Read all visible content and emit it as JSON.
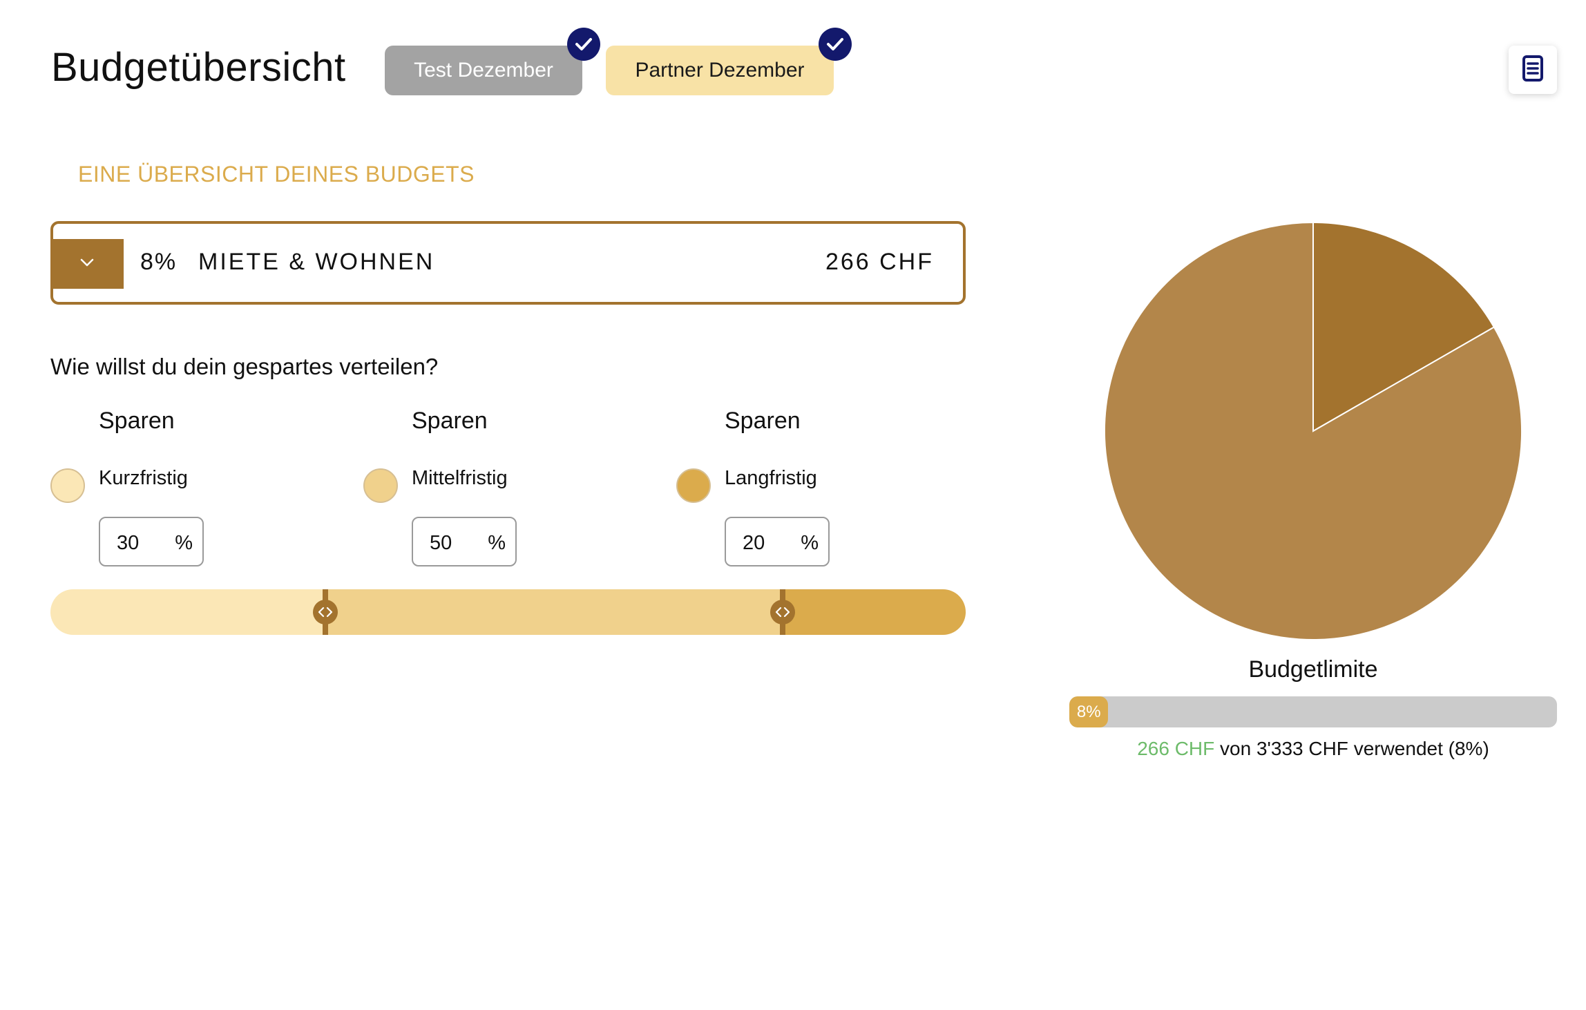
{
  "header": {
    "title": "Budgetübersicht",
    "chips": [
      {
        "label": "Test Dezember",
        "checked": true
      },
      {
        "label": "Partner Dezember",
        "checked": true
      }
    ],
    "doc_icon": "document-icon"
  },
  "overview": {
    "heading": "EINE ÜBERSICHT DEINES BUDGETS",
    "category": {
      "percent": "8%",
      "name": "MIETE & WOHNEN",
      "amount": "266 CHF",
      "toggle_icon": "chevron-down-icon"
    }
  },
  "distribution": {
    "question": "Wie willst du dein gespartes verteilen?",
    "columns": [
      {
        "title": "Sparen",
        "label": "Kurzfristig",
        "value": "30",
        "unit": "%",
        "color": "#fbe7b6"
      },
      {
        "title": "Sparen",
        "label": "Mittelfristig",
        "value": "50",
        "unit": "%",
        "color": "#f0d18c"
      },
      {
        "title": "Sparen",
        "label": "Langfristig",
        "value": "20",
        "unit": "%",
        "color": "#dbab4c"
      }
    ],
    "slider_fractions": [
      0.3,
      0.5,
      0.2
    ]
  },
  "chart_data": {
    "type": "pie",
    "slices": [
      {
        "value": 16.7,
        "color": "#a3732e"
      },
      {
        "value": 83.3,
        "color": "#b3864a"
      }
    ]
  },
  "limit": {
    "title": "Budgetlimite",
    "percent_label": "8%",
    "fraction": 0.08,
    "used": "266 CHF",
    "rest": "von 3'333 CHF verwendet (8%)"
  },
  "colors": {
    "brown": "#a3732e",
    "gold": "#dbab4c",
    "navy": "#13196c",
    "green": "#6dbb6a"
  }
}
